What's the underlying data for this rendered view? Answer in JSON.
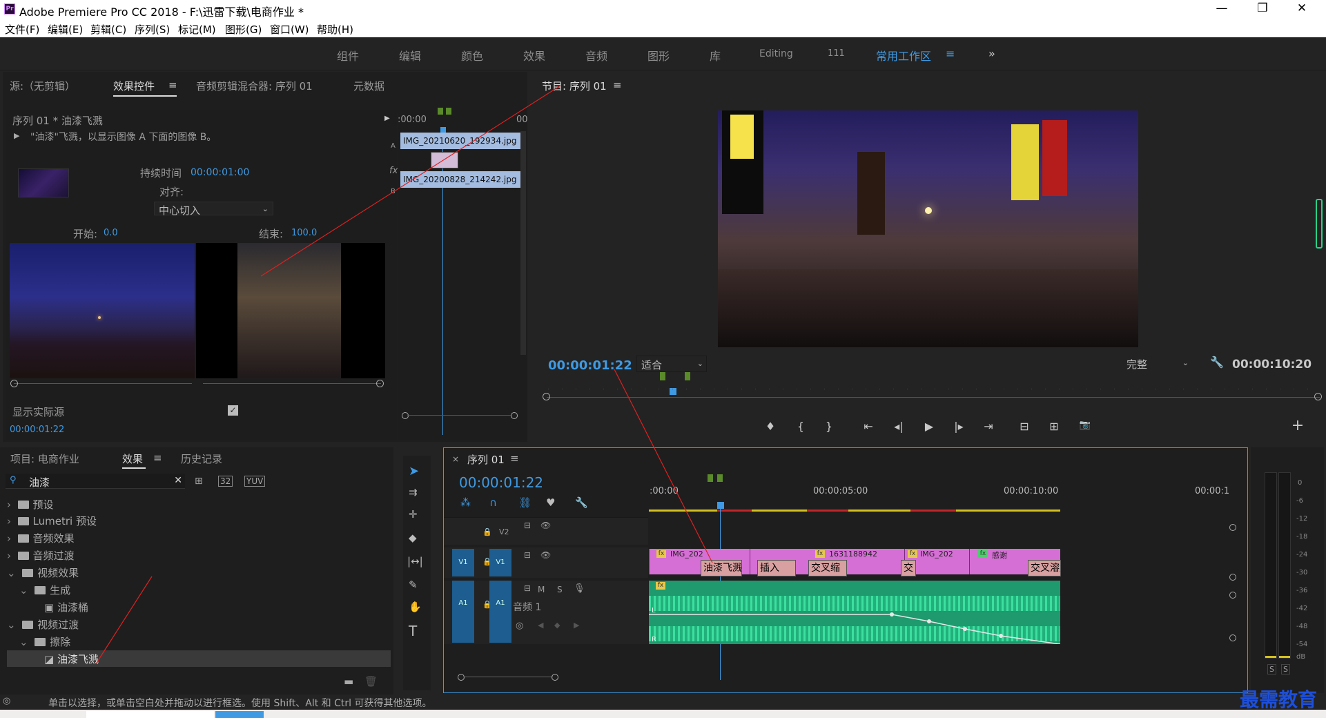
{
  "app": {
    "title": "Adobe Premiere Pro CC 2018 - F:\\迅雷下载\\电商作业 *",
    "icon": "Pr"
  },
  "window": {
    "minimize": "—",
    "restore": "❐",
    "close": "✕"
  },
  "menu": [
    "文件(F)",
    "编辑(E)",
    "剪辑(C)",
    "序列(S)",
    "标记(M)",
    "图形(G)",
    "窗口(W)",
    "帮助(H)"
  ],
  "workspaces": [
    "组件",
    "编辑",
    "颜色",
    "效果",
    "音频",
    "图形",
    "库",
    "Editing",
    "111",
    "常用工作区",
    "≡",
    "»"
  ],
  "source_panel": {
    "tabs": [
      "源:（无剪辑）",
      "效果控件",
      "音频剪辑混合器: 序列 01",
      "元数据"
    ],
    "clip_header": "序列 01 * 油漆飞溅",
    "description": "\"油漆\"飞溅，以显示图像 A 下面的图像 B。",
    "duration_label": "持续时间",
    "duration_value": "00:00:01:00",
    "align_label": "对齐:",
    "align_value": "中心切入",
    "start_label": "开始:",
    "start_value": "0.0",
    "end_label": "结束:",
    "end_value": "100.0",
    "show_actual": "显示实际源",
    "timecode": "00:00:01:22",
    "mini_timeline": {
      "time": ":00:00",
      "time_end": "00",
      "clip_a": "IMG_20210620_192934.jpg",
      "clip_b": "IMG_20200828_214242.jpg",
      "label_a": "A",
      "label_b": "B",
      "label_fx": "fx"
    }
  },
  "program": {
    "title": "节目: 序列 01",
    "timecode": "00:00:01:22",
    "fit": "适合",
    "quality": "完整",
    "duration": "00:00:10:20",
    "controls": [
      "♦",
      "{",
      "}",
      "⇤",
      "◂|",
      "▶",
      "|▸",
      "⇥",
      "⊟",
      "⊞",
      "📷",
      "+"
    ]
  },
  "project": {
    "tabs": [
      "项目: 电商作业",
      "效果",
      "历史记录"
    ],
    "search": "油漆",
    "tree": [
      {
        "label": "预设",
        "level": 0
      },
      {
        "label": "Lumetri 预设",
        "level": 0
      },
      {
        "label": "音频效果",
        "level": 0
      },
      {
        "label": "音频过渡",
        "level": 0
      },
      {
        "label": "视频效果",
        "level": 0,
        "open": true
      },
      {
        "label": "生成",
        "level": 1,
        "open": true
      },
      {
        "label": "油漆桶",
        "level": 2
      },
      {
        "label": "视频过渡",
        "level": 0,
        "open": true
      },
      {
        "label": "擦除",
        "level": 1,
        "open": true
      },
      {
        "label": "油漆飞溅",
        "level": 2,
        "selected": true
      }
    ]
  },
  "timeline": {
    "title": "序列 01",
    "timecode": "00:00:01:22",
    "ruler": [
      ":00:00",
      "00:00:05:00",
      "00:00:10:00",
      "00:00:1"
    ],
    "tracks": {
      "v2": "V2",
      "v1": "V1",
      "a1": "A1",
      "audio_name": "音频 1",
      "m": "M",
      "s": "S"
    },
    "clips": [
      {
        "name": "IMG_202"
      },
      {
        "name": "1631188942"
      },
      {
        "name": "IMG_202"
      },
      {
        "name": "感谢"
      }
    ],
    "transitions": [
      "油漆飞溅",
      "插入",
      "交叉缩",
      "交",
      "交叉溶解"
    ],
    "meter_labels": [
      "0",
      "-6",
      "-12",
      "-18",
      "-24",
      "-30",
      "-36",
      "-42",
      "-48",
      "-54",
      "dB"
    ],
    "meter_solo": [
      "S",
      "S"
    ]
  },
  "status": "单击以选择，或单击空白处并拖动以进行框选。使用 Shift、Alt 和 Ctrl 可获得其他选项。",
  "watermark": "最需教育"
}
